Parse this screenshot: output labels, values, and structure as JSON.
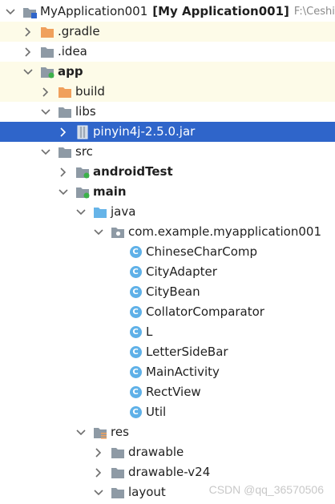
{
  "tree": {
    "root": {
      "name": "MyApplication001",
      "module": "[My Application001]",
      "path": "F:\\Ceshi\\"
    },
    "gradle": ".gradle",
    "idea": ".idea",
    "app": "app",
    "build": "build",
    "libs": "libs",
    "jar": "pinyin4j-2.5.0.jar",
    "src": "src",
    "androidTest": "androidTest",
    "main": "main",
    "java": "java",
    "package": "com.example.myapplication001",
    "classes": [
      "ChineseCharComp",
      "CityAdapter",
      "CityBean",
      "CollatorComparator",
      "L",
      "LetterSideBar",
      "MainActivity",
      "RectView",
      "Util"
    ],
    "class_badge": "C",
    "res": "res",
    "drawable": "drawable",
    "drawable_v24": "drawable-v24",
    "layout": "layout"
  },
  "watermark": "CSDN @qq_36570506",
  "colors": {
    "selection": "#2f65ca",
    "highlight_row": "#fdfbe8",
    "folder_gray": "#8e9aa5",
    "folder_orange": "#f0a05c",
    "folder_blue": "#66b4e8",
    "module_dot": "#3cb14a",
    "class_badge": "#5fb1e8"
  },
  "icons": {
    "expand": "chevron-down-icon",
    "collapse": "chevron-right-icon",
    "folder": "folder-icon",
    "module": "module-folder-icon",
    "excluded": "excluded-folder-icon",
    "source_root": "source-folder-icon",
    "package": "package-folder-icon",
    "resources": "resource-folder-icon",
    "jar": "jar-file-icon",
    "class": "class-icon"
  }
}
